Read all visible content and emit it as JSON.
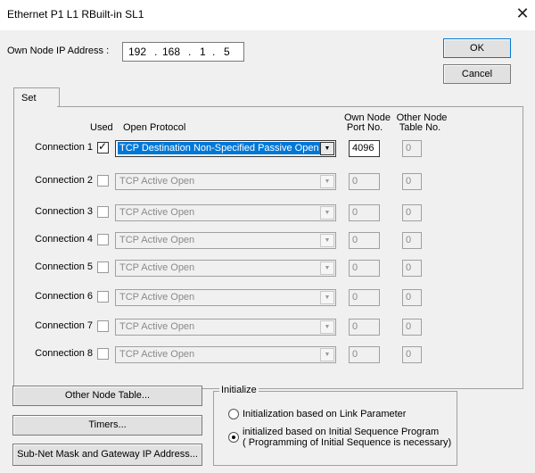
{
  "window": {
    "title": "Ethernet  P1 L1 RBuilt-in SL1"
  },
  "ip": {
    "label": "Own Node IP Address :",
    "octets": [
      "192",
      "168",
      "1",
      "5"
    ]
  },
  "buttons": {
    "ok": "OK",
    "cancel": "Cancel",
    "other_node_table": "Other Node Table...",
    "timers": "Timers...",
    "subnet": "Sub-Net Mask and Gateway IP Address..."
  },
  "tab": {
    "label": "Set"
  },
  "headers": {
    "used": "Used",
    "open_protocol": "Open Protocol",
    "own_port_1": "Own Node",
    "own_port_2": "Port No.",
    "other_table_1": "Other Node",
    "other_table_2": "Table No."
  },
  "connections": [
    {
      "label": "Connection 1",
      "used": true,
      "protocol": "TCP Destination Non-Specified Passive Open",
      "port": "4096",
      "table": "0"
    },
    {
      "label": "Connection 2",
      "used": false,
      "protocol": "TCP Active Open",
      "port": "0",
      "table": "0"
    },
    {
      "label": "Connection 3",
      "used": false,
      "protocol": "TCP Active Open",
      "port": "0",
      "table": "0"
    },
    {
      "label": "Connection 4",
      "used": false,
      "protocol": "TCP Active Open",
      "port": "0",
      "table": "0"
    },
    {
      "label": "Connection 5",
      "used": false,
      "protocol": "TCP Active Open",
      "port": "0",
      "table": "0"
    },
    {
      "label": "Connection 6",
      "used": false,
      "protocol": "TCP Active Open",
      "port": "0",
      "table": "0"
    },
    {
      "label": "Connection 7",
      "used": false,
      "protocol": "TCP Active Open",
      "port": "0",
      "table": "0"
    },
    {
      "label": "Connection 8",
      "used": false,
      "protocol": "TCP Active Open",
      "port": "0",
      "table": "0"
    }
  ],
  "initialize": {
    "title": "Initialize",
    "option1": "Initialization based on Link Parameter",
    "option2_line1": "initialized based on Initial Sequence Program",
    "option2_line2": "( Programming of Initial Sequence is necessary)",
    "selected": "option2"
  },
  "colors": {
    "selection": "#0078d7",
    "window_bg": "#f0f0f0"
  }
}
